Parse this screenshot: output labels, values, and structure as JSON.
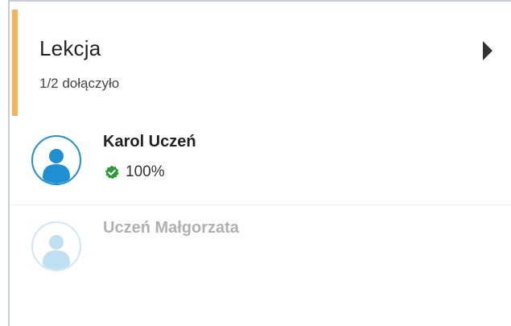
{
  "panel": {
    "title": "Lekcja",
    "subtitle": "1/2 dołączyło",
    "accent_color": "#f4b25a"
  },
  "participants": [
    {
      "name": "Karol Uczeń",
      "status_icon": "verified-check-icon",
      "status_text": "100%",
      "avatar_color": "#1e8fd0",
      "active": true
    },
    {
      "name": "Uczeń Małgorzata",
      "status_text": "",
      "avatar_color": "#cfe7f5",
      "active": false
    }
  ],
  "colors": {
    "check_green": "#2e9a3a",
    "border": "#c8ccd4"
  }
}
